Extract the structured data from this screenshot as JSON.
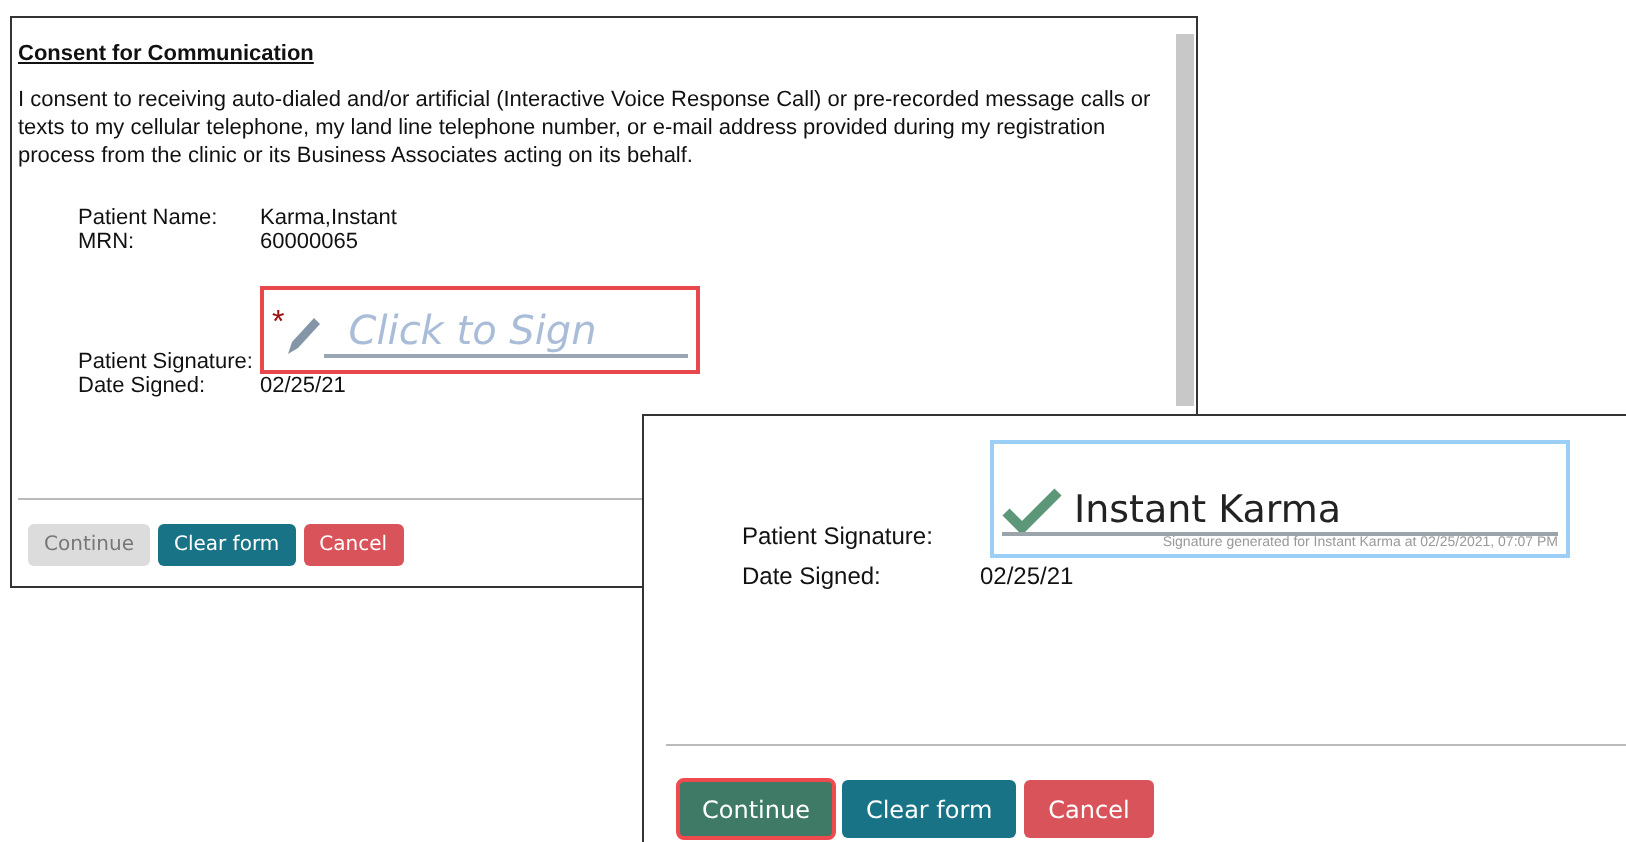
{
  "consent_form": {
    "heading": "Consent for Communication",
    "paragraph": "I consent to receiving auto-dialed and/or artificial (Interactive Voice Response Call) or pre-recorded message calls or texts to my cellular telephone, my land line telephone number, or e-mail address provided during my registration process from the clinic or its Business Associates acting on its behalf.",
    "fields": [
      {
        "label": "Patient Name:",
        "value": "Karma,Instant"
      },
      {
        "label": "MRN:",
        "value": "60000065"
      }
    ],
    "signature": {
      "label": "Patient Signature:",
      "signed": false,
      "required_mark": "*",
      "placeholder": "Click to Sign"
    },
    "date": {
      "label": "Date Signed:",
      "value": "02/25/21"
    },
    "buttons": [
      {
        "label": "Continue",
        "kind": "primary",
        "disabled": true,
        "focused": false
      },
      {
        "label": "Clear form",
        "kind": "secondary",
        "disabled": false,
        "focused": false
      },
      {
        "label": "Cancel",
        "kind": "danger",
        "disabled": false,
        "focused": false
      }
    ]
  },
  "signed_form": {
    "signature": {
      "label": "Patient Signature:",
      "signed": true,
      "text": "Instant Karma",
      "caption": "Signature generated for Instant Karma at 02/25/2021, 07:07 PM"
    },
    "date": {
      "label": "Date Signed:",
      "value": "02/25/21"
    },
    "buttons": [
      {
        "label": "Continue",
        "kind": "primary",
        "disabled": false,
        "focused": true
      },
      {
        "label": "Clear form",
        "kind": "secondary",
        "disabled": false,
        "focused": false
      },
      {
        "label": "Cancel",
        "kind": "danger",
        "disabled": false,
        "focused": false
      }
    ]
  }
}
